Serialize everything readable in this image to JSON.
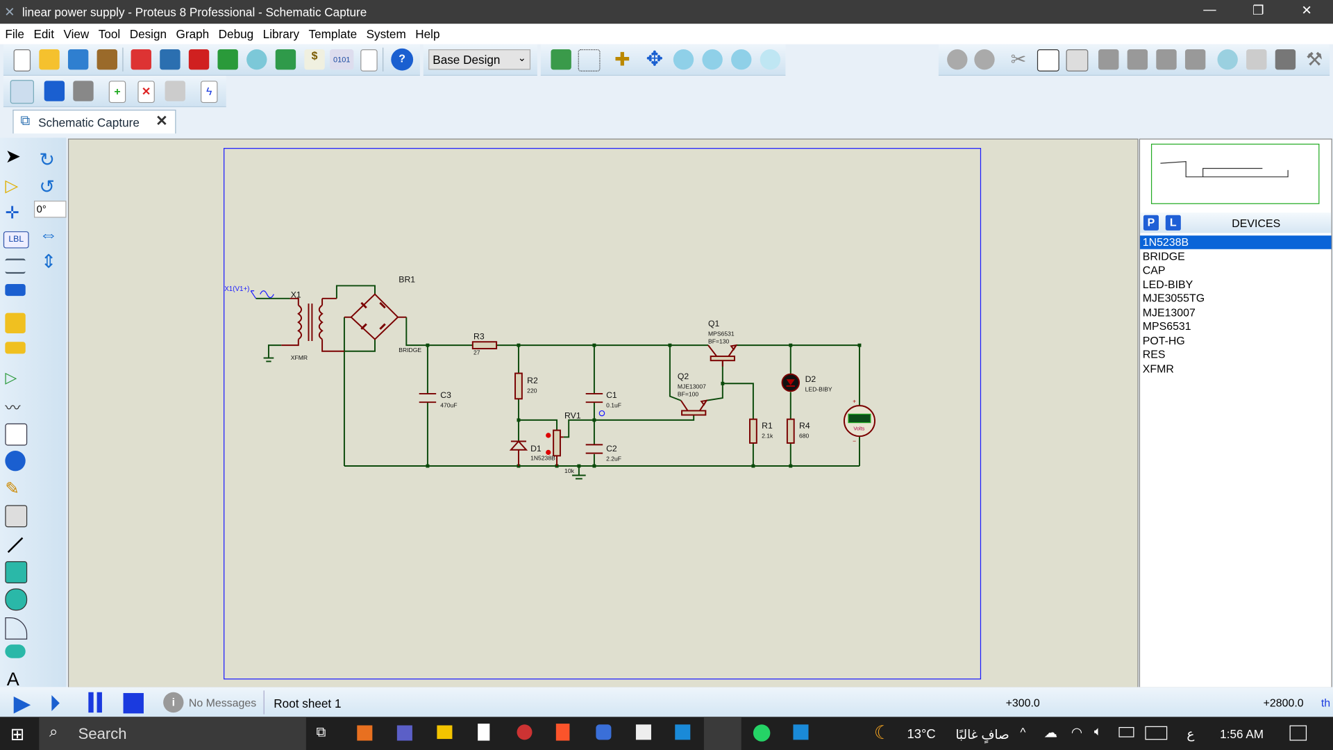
{
  "window": {
    "title": "linear power supply - Proteus 8 Professional - Schematic Capture",
    "minimize": "—",
    "maximize": "❐",
    "close": "✕"
  },
  "menu": [
    "File",
    "Edit",
    "View",
    "Tool",
    "Design",
    "Graph",
    "Debug",
    "Library",
    "Template",
    "System",
    "Help"
  ],
  "toolbar": {
    "variant_select": "Base Design"
  },
  "tab": {
    "label": "Schematic Capture",
    "close": "✕"
  },
  "left_tools": {
    "rotation": "0°",
    "label_tool": "LBL"
  },
  "schematic": {
    "labels": {
      "terminal": "X1(V1+)",
      "x1": "X1",
      "x1_value": "XFMR",
      "br1": "BR1",
      "br1_value": "BRIDGE",
      "r3": "R3",
      "r3_value": "27",
      "c3": "C3",
      "c3_value": "470uF",
      "r2": "R2",
      "r2_value": "220",
      "d1": "D1",
      "d1_value": "1N5238B",
      "rv1": "RV1",
      "rv1_value": "10k",
      "c1": "C1",
      "c1_value": "0.1uF",
      "c2": "C2",
      "c2_value": "2.2uF",
      "q1": "Q1",
      "q1_value": "MPS6531",
      "q1_bf": "BF=130",
      "q2": "Q2",
      "q2_value": "MJE13007",
      "q2_bf": "BF=100",
      "r1": "R1",
      "r1_value": "2.1k",
      "r4": "R4",
      "r4_value": "680",
      "d2": "D2",
      "d2_value": "LED-BIBY",
      "voltmeter_unit": "Volts",
      "voltmeter_plus": "+",
      "voltmeter_minus": "−"
    },
    "colors": {
      "wire": "#0b4a0b",
      "component": "#7a0000",
      "sheet_border": "#1a1aff",
      "background": "#dfdfcf"
    }
  },
  "devices_panel": {
    "p_button": "P",
    "l_button": "L",
    "title": "DEVICES",
    "items": [
      "1N5238B",
      "BRIDGE",
      "CAP",
      "LED-BIBY",
      "MJE3055TG",
      "MJE13007",
      "MPS6531",
      "POT-HG",
      "RES",
      "XFMR"
    ],
    "selected": "1N5238B"
  },
  "status": {
    "messages": "No Messages",
    "sheet": "Root sheet 1",
    "x_coord": "+300.0",
    "y_coord": "+2800.0",
    "units": "th"
  },
  "taskbar": {
    "search": "Search",
    "weather": "13°C",
    "weather_text": "صافٍ غالبًا",
    "lang": "ع",
    "time": "1:56 AM"
  }
}
